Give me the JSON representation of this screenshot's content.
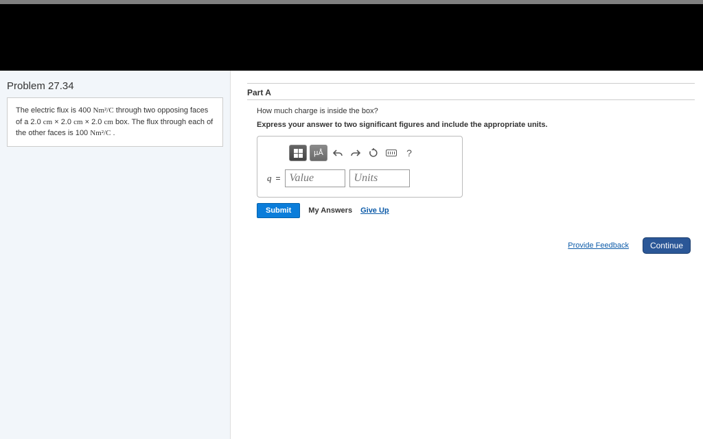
{
  "problem_title": "Problem 27.34",
  "problem_text": {
    "p1a": "The electric flux is 400 ",
    "unit1": "Nm²/C",
    "p1b": " through two opposing faces of a 2.0 ",
    "cm": "cm",
    "x": " × 2.0 ",
    "x2": " × 2.0 ",
    "box": " box. The flux through each of the other faces is 100 ",
    "unit2": "Nm²/C",
    "end": " ."
  },
  "part_label": "Part A",
  "question": "How much charge is inside the box?",
  "instruction": "Express your answer to two significant figures and include the appropriate units.",
  "toolbar": {
    "units_btn": "µÅ",
    "help": "?"
  },
  "input": {
    "var": "q",
    "equals": "=",
    "value_placeholder": "Value",
    "units_placeholder": "Units"
  },
  "actions": {
    "submit": "Submit",
    "my_answers": "My Answers",
    "give_up": "Give Up"
  },
  "footer": {
    "feedback": "Provide Feedback",
    "continue": "Continue"
  }
}
